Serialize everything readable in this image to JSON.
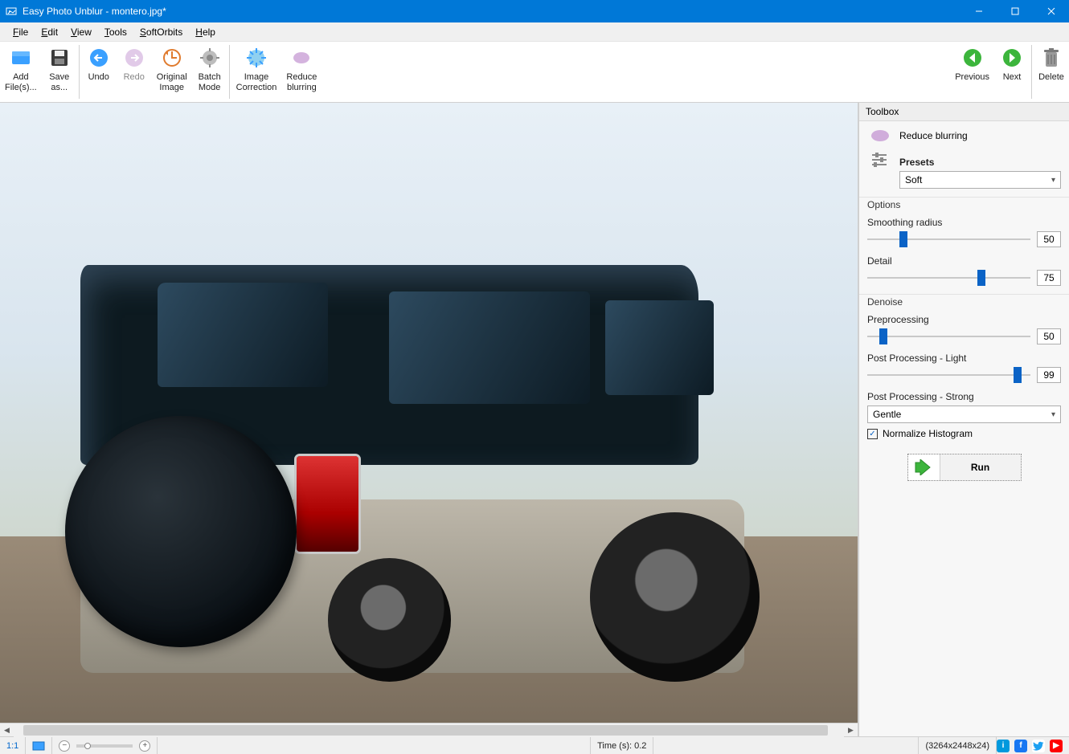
{
  "window": {
    "title": "Easy Photo Unblur - montero.jpg*"
  },
  "menu": {
    "file": "File",
    "edit": "Edit",
    "view": "View",
    "tools": "Tools",
    "softorbits": "SoftOrbits",
    "help": "Help"
  },
  "toolbar": {
    "add_files": "Add\nFile(s)...",
    "save_as": "Save\nas...",
    "undo": "Undo",
    "redo": "Redo",
    "original_image": "Original\nImage",
    "batch_mode": "Batch\nMode",
    "image_correction": "Image\nCorrection",
    "reduce_blurring": "Reduce\nblurring",
    "previous": "Previous",
    "next": "Next",
    "delete": "Delete"
  },
  "toolbox": {
    "title": "Toolbox",
    "mode_label": "Reduce blurring",
    "presets_label": "Presets",
    "preset_selected": "Soft",
    "options_label": "Options",
    "smoothing_radius_label": "Smoothing radius",
    "smoothing_radius_value": "50",
    "detail_label": "Detail",
    "detail_value": "75",
    "denoise_label": "Denoise",
    "preprocessing_label": "Preprocessing",
    "preprocessing_value": "50",
    "post_light_label": "Post Processing - Light",
    "post_light_value": "99",
    "post_strong_label": "Post Processing - Strong",
    "post_strong_selected": "Gentle",
    "normalize_histogram_label": "Normalize Histogram",
    "normalize_histogram_checked": true,
    "run_label": "Run"
  },
  "status": {
    "ratio": "1:1",
    "time": "Time (s): 0.2",
    "dims": "(3264x2448x24)"
  },
  "colors": {
    "accent": "#0078d7",
    "slider": "#0b63c6",
    "nav_prev": "#2aa52a",
    "nav_next": "#2aa52a"
  },
  "slider_percents": {
    "smoothing_radius": 22,
    "detail": 70,
    "preprocessing": 10,
    "post_light": 92
  }
}
